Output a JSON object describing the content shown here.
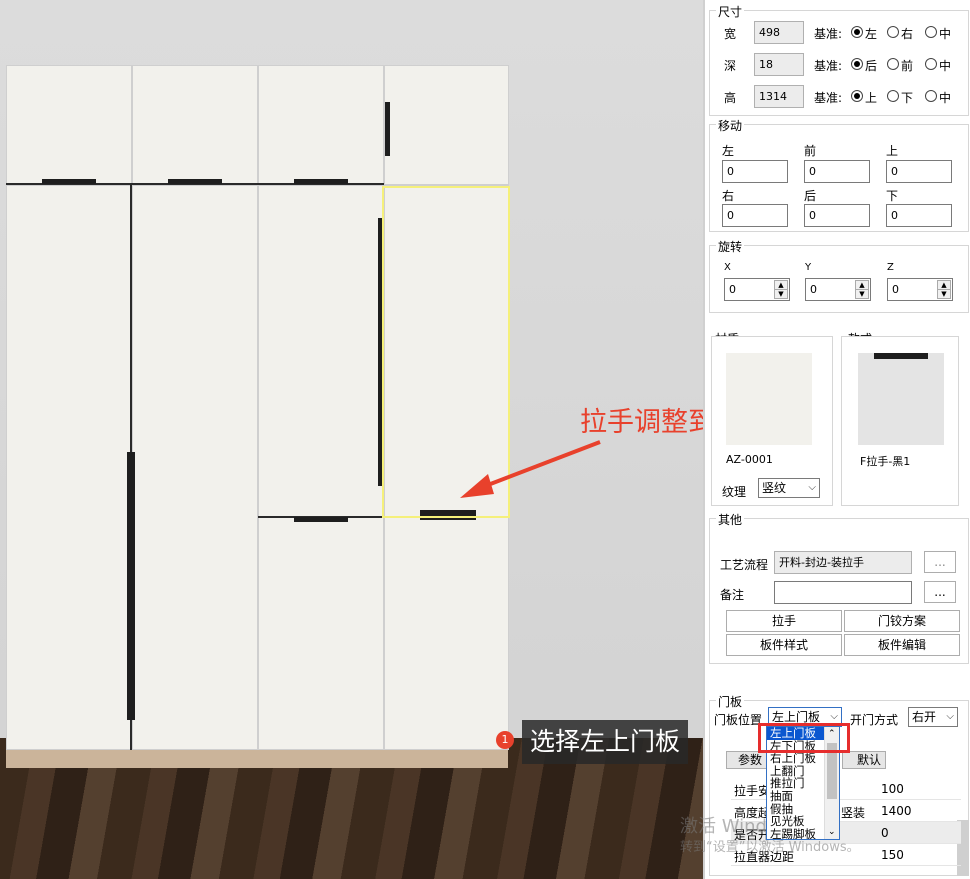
{
  "annotation": {
    "text": "拉手调整到下端的效果"
  },
  "step": {
    "number": "1",
    "label": "选择左上门板"
  },
  "watermark": {
    "line1": "激活 Windows",
    "line2": "转到“设置”以激活 Windows。"
  },
  "size": {
    "title": "尺寸",
    "rows": [
      {
        "label": "宽",
        "value": "498",
        "basis_label": "基准:",
        "options": [
          "左",
          "右",
          "中"
        ],
        "selected": "左"
      },
      {
        "label": "深",
        "value": "18",
        "basis_label": "基准:",
        "options": [
          "后",
          "前",
          "中"
        ],
        "selected": "后"
      },
      {
        "label": "高",
        "value": "1314",
        "basis_label": "基准:",
        "options": [
          "上",
          "下",
          "中"
        ],
        "selected": "上"
      }
    ]
  },
  "move": {
    "title": "移动",
    "fields": [
      {
        "label": "左",
        "value": "0"
      },
      {
        "label": "前",
        "value": "0"
      },
      {
        "label": "上",
        "value": "0"
      },
      {
        "label": "右",
        "value": "0"
      },
      {
        "label": "后",
        "value": "0"
      },
      {
        "label": "下",
        "value": "0"
      }
    ]
  },
  "rotate": {
    "title": "旋转",
    "fields": [
      {
        "label": "X",
        "value": "0"
      },
      {
        "label": "Y",
        "value": "0"
      },
      {
        "label": "Z",
        "value": "0"
      }
    ]
  },
  "material": {
    "title": "材质",
    "code": "AZ-0001",
    "grain_label": "纹理",
    "grain_value": "竖纹"
  },
  "style": {
    "title": "款式",
    "name": "F拉手-黑1"
  },
  "other": {
    "title": "其他",
    "process_label": "工艺流程",
    "process_value": "开料-封边-装拉手",
    "remark_label": "备注",
    "remark_value": "",
    "more": "...",
    "buttons": [
      "拉手",
      "门铰方案",
      "板件样式",
      "板件编辑"
    ]
  },
  "door": {
    "title": "门板",
    "position_label": "门板位置",
    "position_value": "左上门板",
    "open_label": "开门方式",
    "open_value": "右开",
    "options": [
      "左上门板",
      "左下门板",
      "右上门板",
      "上翻门",
      "推拉门",
      "抽面",
      "假抽",
      "见光板",
      "左踢脚板"
    ],
    "params_label": "参数",
    "default_label": "默认"
  },
  "params": [
    {
      "key": "拉手安",
      "value": "100"
    },
    {
      "key": "高度起",
      "value": "1400",
      "extra": "竖装"
    },
    {
      "key": "是否开",
      "value": "0"
    },
    {
      "key": "拉直器边距",
      "value": "150"
    }
  ],
  "colors": {
    "accent": "#e8412c",
    "highlight": "#f5f07a",
    "panel": "#f2f1ec",
    "select_blue": "#0b57d0"
  }
}
